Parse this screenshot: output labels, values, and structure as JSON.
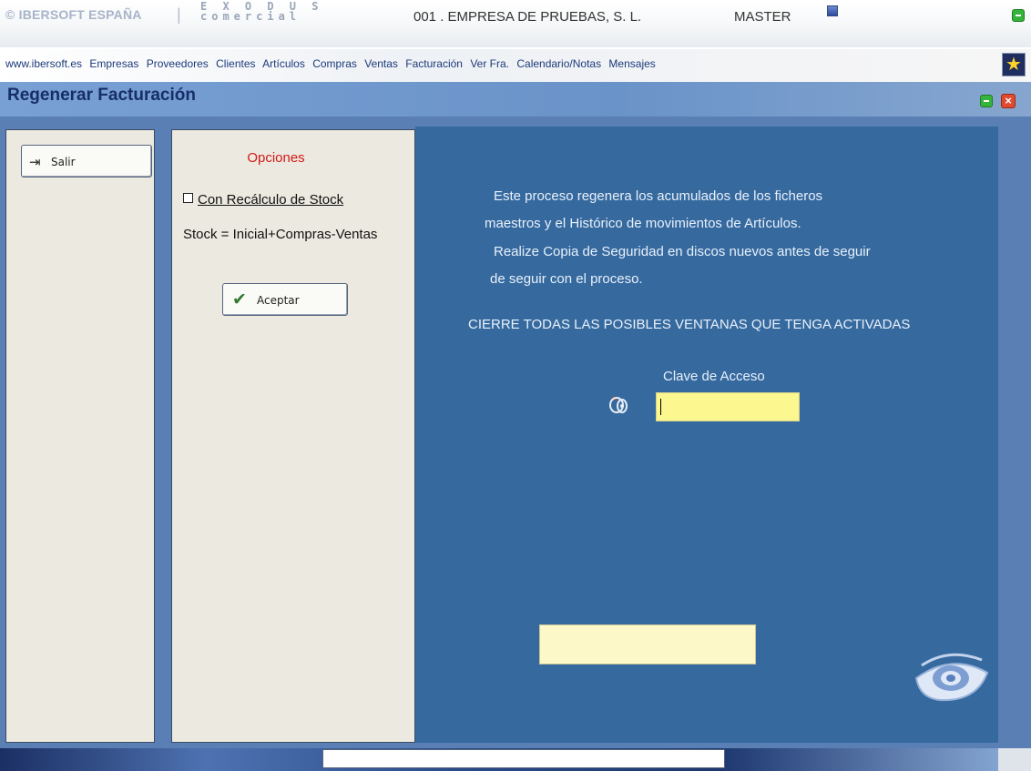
{
  "header": {
    "brand": "© IBERSOFT ESPAÑA",
    "product_line1": "E X O D U S",
    "product_line2": "comercial",
    "company": "001 . EMPRESA DE PRUEBAS, S. L.",
    "user": "MASTER"
  },
  "menu": {
    "items": [
      "www.ibersoft.es",
      "Empresas",
      "Proveedores",
      "Clientes",
      "Artículos",
      "Compras",
      "Ventas",
      "Facturación",
      "Ver Fra.",
      "Calendario/Notas",
      "Mensajes"
    ]
  },
  "window": {
    "title": "Regenerar Facturación"
  },
  "left": {
    "salir_label": "Salir"
  },
  "options": {
    "title": "Opciones",
    "checkbox_label": "Con Recálculo de Stock",
    "formula": "Stock = Inicial+Compras-Ventas",
    "accept_label": "Aceptar"
  },
  "main": {
    "message_lines": [
      "Este proceso regenera los acumulados de los ficheros",
      "maestros y el Histórico de movimientos de Artículos.",
      "Realize Copia de Seguridad en discos nuevos antes de seguir",
      "de seguir con el proceso."
    ],
    "warning": "CIERRE TODAS LAS POSIBLES VENTANAS QUE TENGA ACTIVADAS",
    "password_label": "Clave de Acceso",
    "password_value": ""
  },
  "icons": {
    "exit": "exit-door-icon",
    "accept": "checkmark-icon",
    "key": "key-icon",
    "eye": "eye-logo-icon",
    "star": "star-icon",
    "user": "user-icon",
    "minimize": "minimize-icon",
    "close": "close-icon"
  },
  "colors": {
    "main_panel": "#366a9f",
    "panel_bg": "#eceae0",
    "input_yellow": "#fcf78f",
    "options_title": "#d31818",
    "title_bar": "#6a93c9"
  }
}
